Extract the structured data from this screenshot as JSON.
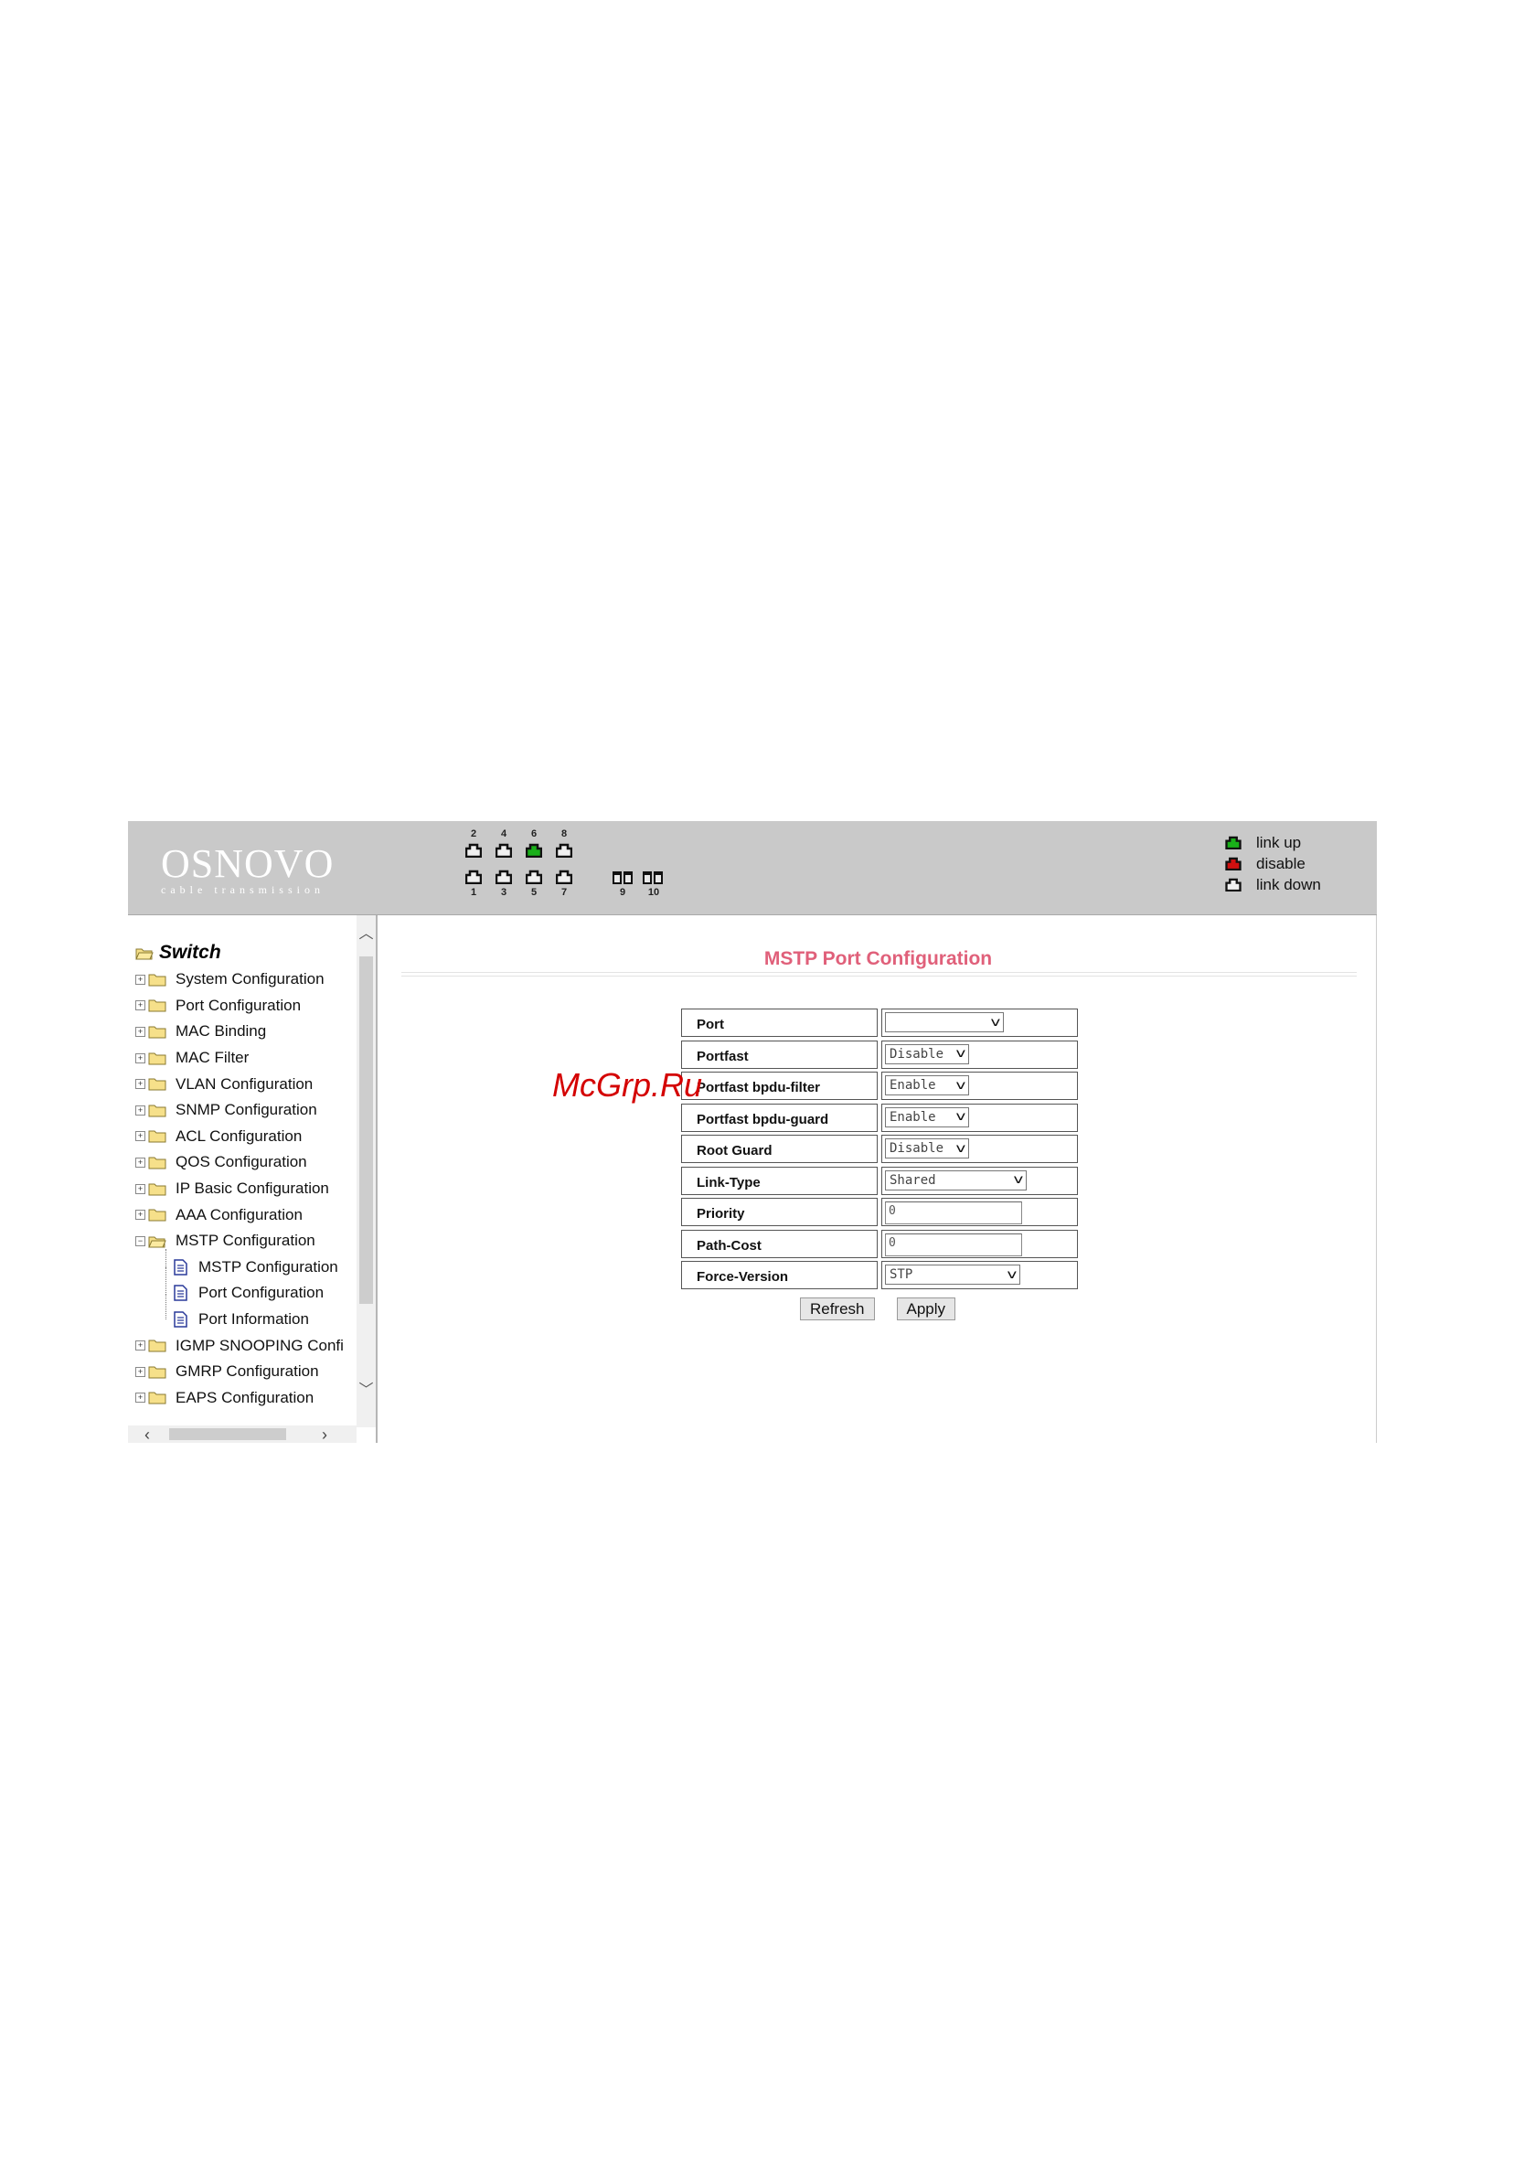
{
  "logo": {
    "name": "OSNOVO",
    "tagline": "cable transmission"
  },
  "ports": {
    "top_numbers": [
      "2",
      "4",
      "6",
      "8"
    ],
    "bottom_numbers": [
      "1",
      "3",
      "5",
      "7"
    ],
    "sfp_numbers": [
      "9",
      "10"
    ],
    "status": {
      "1": "link down",
      "2": "link down",
      "3": "link down",
      "4": "link down",
      "5": "link down",
      "6": "link up",
      "7": "link down",
      "8": "link down"
    }
  },
  "legend": {
    "link_up": "link up",
    "disable": "disable",
    "link_down": "link down",
    "colors": {
      "link_up": "#19b019",
      "disable": "#d01010",
      "link_down": "#f0f0f0"
    }
  },
  "sidebar": {
    "root": "Switch",
    "items": [
      {
        "label": "System Configuration"
      },
      {
        "label": "Port Configuration"
      },
      {
        "label": "MAC Binding"
      },
      {
        "label": "MAC Filter"
      },
      {
        "label": "VLAN Configuration"
      },
      {
        "label": "SNMP Configuration"
      },
      {
        "label": "ACL Configuration"
      },
      {
        "label": "QOS Configuration"
      },
      {
        "label": "IP Basic Configuration"
      },
      {
        "label": "AAA Configuration"
      },
      {
        "label": "MSTP Configuration",
        "expanded": true,
        "children": [
          "MSTP Configuration",
          "Port Configuration",
          "Port Information"
        ]
      },
      {
        "label": "IGMP SNOOPING Confi"
      },
      {
        "label": "GMRP Configuration"
      },
      {
        "label": "EAPS Configuration"
      }
    ]
  },
  "main": {
    "title": "MSTP Port Configuration",
    "fields": [
      {
        "label": "Port",
        "type": "select",
        "value": ""
      },
      {
        "label": "Portfast",
        "type": "select",
        "value": "Disable"
      },
      {
        "label": "Portfast bpdu-filter",
        "type": "select",
        "value": "Enable"
      },
      {
        "label": "Portfast bpdu-guard",
        "type": "select",
        "value": "Enable"
      },
      {
        "label": "Root Guard",
        "type": "select",
        "value": "Disable"
      },
      {
        "label": "Link-Type",
        "type": "select",
        "value": "Shared"
      },
      {
        "label": "Priority",
        "type": "input",
        "value": "0"
      },
      {
        "label": "Path-Cost",
        "type": "input",
        "value": "0"
      },
      {
        "label": "Force-Version",
        "type": "select",
        "value": "STP"
      }
    ],
    "buttons": {
      "refresh": "Refresh",
      "apply": "Apply"
    }
  },
  "watermark": "McGrp.Ru"
}
